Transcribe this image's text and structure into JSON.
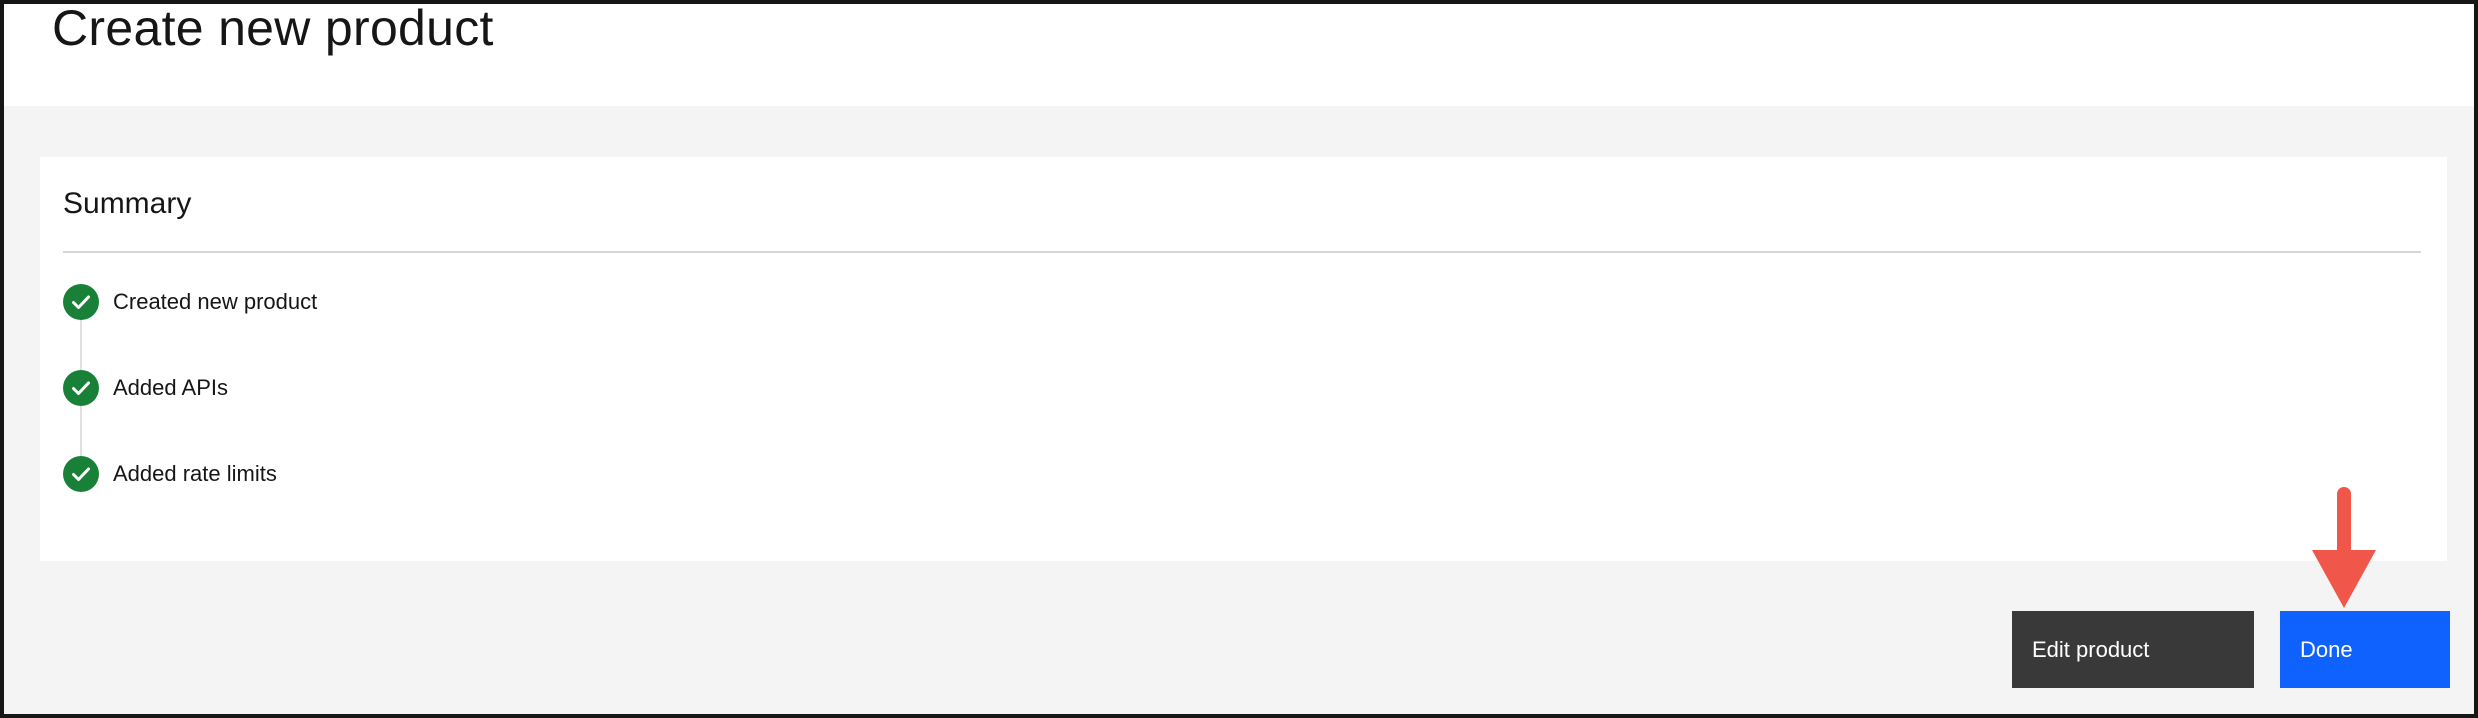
{
  "page": {
    "title": "Create new product"
  },
  "summary": {
    "title": "Summary",
    "steps": [
      {
        "label": "Created new product",
        "status": "complete"
      },
      {
        "label": "Added APIs",
        "status": "complete"
      },
      {
        "label": "Added rate limits",
        "status": "complete"
      }
    ]
  },
  "actions": {
    "edit_label": "Edit product",
    "done_label": "Done"
  },
  "colors": {
    "success": "#198038",
    "primary": "#0f62fe",
    "secondary": "#393939",
    "annotation_arrow": "#f1564a"
  }
}
